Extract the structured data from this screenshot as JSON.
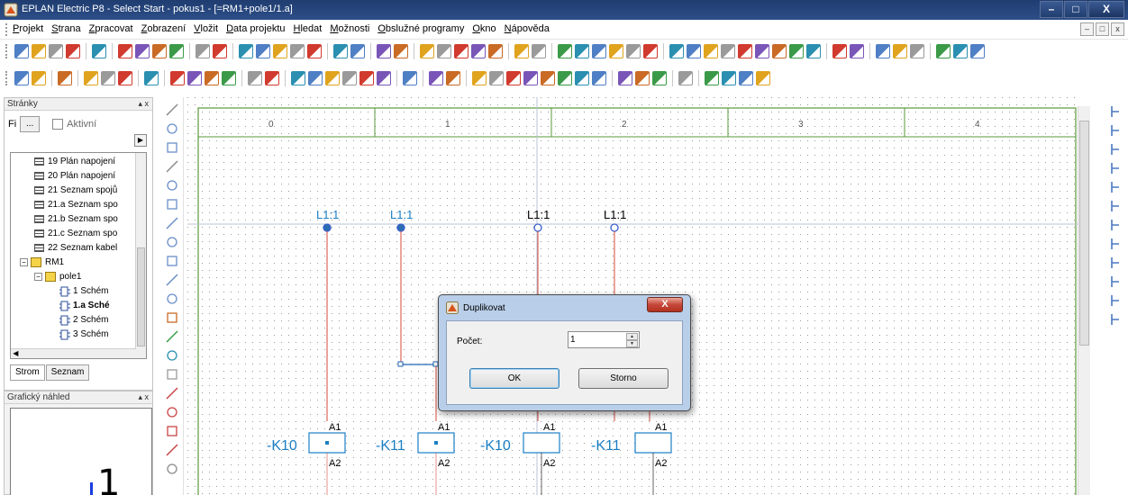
{
  "window": {
    "title": "EPLAN Electric P8 - Select Start - pokus1 - [=RM1+pole1/1.a]",
    "min_label": "–",
    "max_label": "□",
    "close_label": "X"
  },
  "menu": {
    "items": [
      {
        "accel": "P",
        "rest": "rojekt"
      },
      {
        "accel": "S",
        "rest": "trana"
      },
      {
        "accel": "Z",
        "rest": "pracovat"
      },
      {
        "accel": "Z",
        "rest": "obrazení"
      },
      {
        "accel": "V",
        "rest": "ložit"
      },
      {
        "accel": "D",
        "rest": "ata projektu"
      },
      {
        "accel": "H",
        "rest": "ledat"
      },
      {
        "accel": "M",
        "rest": "ožnosti"
      },
      {
        "accel": "O",
        "rest": "bslužné programy"
      },
      {
        "accel": "O",
        "rest": "kno"
      },
      {
        "accel": "N",
        "rest": "ápověda"
      }
    ],
    "mdi": [
      "–",
      "□",
      "x"
    ]
  },
  "pages_panel": {
    "title": "Stránky",
    "pin": "▴ x",
    "filter_label": "Fi",
    "filter_button": "...",
    "active_label": "Aktivní",
    "tree": [
      {
        "label": "19 Plán napojení",
        "kind": "page"
      },
      {
        "label": "20 Plán napojení",
        "kind": "page"
      },
      {
        "label": "21 Seznam spojů",
        "kind": "page"
      },
      {
        "label": "21.a Seznam spo",
        "kind": "page"
      },
      {
        "label": "21.b Seznam spo",
        "kind": "page"
      },
      {
        "label": "21.c Seznam spo",
        "kind": "page"
      },
      {
        "label": "22 Seznam kabel",
        "kind": "page"
      },
      {
        "label": "RM1",
        "kind": "folder"
      },
      {
        "label": "pole1",
        "kind": "folder"
      },
      {
        "label": "1 Schém",
        "kind": "schematic"
      },
      {
        "label": "1.a Sché",
        "kind": "schematic"
      },
      {
        "label": "2 Schém",
        "kind": "schematic"
      },
      {
        "label": "3 Schém",
        "kind": "schematic"
      }
    ],
    "tabs": [
      "Strom",
      "Seznam"
    ]
  },
  "preview_panel": {
    "title": "Grafický náhled",
    "pin": "▴ x",
    "preview_text": "1"
  },
  "canvas": {
    "columns": [
      "0",
      "1",
      "2",
      "3",
      "4"
    ],
    "potentials": [
      "L1:1",
      "L1:1",
      "L1:1",
      "L1:1"
    ],
    "devices": [
      {
        "tag": "-K10",
        "a1": "A1",
        "a2": "A2"
      },
      {
        "tag": "-K11",
        "a1": "A1",
        "a2": "A2"
      },
      {
        "tag": "-K10",
        "a1": "A1",
        "a2": "A2"
      },
      {
        "tag": "-K11",
        "a1": "A1",
        "a2": "A2"
      }
    ],
    "colors": {
      "border": "#5a9a3a",
      "wire": "#d44a3a",
      "device": "#1a7fc4",
      "blue_node": "#3a5fd0",
      "selected": "#2166b2"
    }
  },
  "dialog": {
    "title": "Duplikovat",
    "close": "X",
    "count_label": "Počet:",
    "count_value": "1",
    "ok": "OK",
    "cancel": "Storno"
  }
}
